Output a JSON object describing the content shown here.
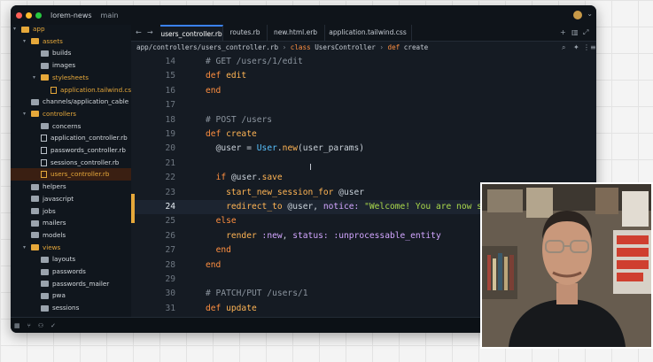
{
  "window": {
    "title": "lorem-news",
    "branch": "main",
    "colors": {
      "bg": "#151b23",
      "accent": "#ff8f40",
      "folder": "#e6a83a",
      "active_tab": "#3b82f6"
    }
  },
  "sidebar": {
    "items": [
      {
        "label": "app",
        "kind": "folder",
        "depth": 0,
        "orange": true,
        "open": true
      },
      {
        "label": "assets",
        "kind": "folder",
        "depth": 1,
        "orange": true,
        "open": true
      },
      {
        "label": "builds",
        "kind": "folder",
        "depth": 2,
        "orange": false
      },
      {
        "label": "images",
        "kind": "folder",
        "depth": 2,
        "orange": false
      },
      {
        "label": "stylesheets",
        "kind": "folder",
        "depth": 2,
        "orange": true,
        "open": true
      },
      {
        "label": "application.tailwind.css",
        "kind": "file",
        "depth": 3,
        "orange": true
      },
      {
        "label": "channels/application_cable",
        "kind": "folder",
        "depth": 1,
        "orange": false
      },
      {
        "label": "controllers",
        "kind": "folder",
        "depth": 1,
        "orange": true,
        "open": true
      },
      {
        "label": "concerns",
        "kind": "folder",
        "depth": 2,
        "orange": false
      },
      {
        "label": "application_controller.rb",
        "kind": "file",
        "depth": 2,
        "orange": false
      },
      {
        "label": "passwords_controller.rb",
        "kind": "file",
        "depth": 2,
        "orange": false
      },
      {
        "label": "sessions_controller.rb",
        "kind": "file",
        "depth": 2,
        "orange": false
      },
      {
        "label": "users_controller.rb",
        "kind": "file",
        "depth": 2,
        "orange": true,
        "active": true
      },
      {
        "label": "helpers",
        "kind": "folder",
        "depth": 1,
        "orange": false
      },
      {
        "label": "javascript",
        "kind": "folder",
        "depth": 1,
        "orange": false
      },
      {
        "label": "jobs",
        "kind": "folder",
        "depth": 1,
        "orange": false
      },
      {
        "label": "mailers",
        "kind": "folder",
        "depth": 1,
        "orange": false
      },
      {
        "label": "models",
        "kind": "folder",
        "depth": 1,
        "orange": false
      },
      {
        "label": "views",
        "kind": "folder",
        "depth": 1,
        "orange": true,
        "open": true
      },
      {
        "label": "layouts",
        "kind": "folder",
        "depth": 2,
        "orange": false
      },
      {
        "label": "passwords",
        "kind": "folder",
        "depth": 2,
        "orange": false
      },
      {
        "label": "passwords_mailer",
        "kind": "folder",
        "depth": 2,
        "orange": false
      },
      {
        "label": "pwa",
        "kind": "folder",
        "depth": 2,
        "orange": false
      },
      {
        "label": "sessions",
        "kind": "folder",
        "depth": 2,
        "orange": false
      }
    ]
  },
  "tabs": [
    {
      "label": "users_controller.rb",
      "active": true
    },
    {
      "label": "routes.rb",
      "active": false
    },
    {
      "label": "new.html.erb",
      "active": false
    },
    {
      "label": "application.tailwind.css",
      "active": false
    }
  ],
  "breadcrumb": {
    "path": "app/controllers/users_controller.rb",
    "sep": "›",
    "class_kw": "class",
    "class_name": "UsersController",
    "def_kw": "def",
    "method": "create"
  },
  "code": [
    {
      "n": "14",
      "tokens": [
        [
          "com",
          "# GET /users/1/edit"
        ]
      ]
    },
    {
      "n": "15",
      "tokens": [
        [
          "kw",
          "def"
        ],
        [
          "plain",
          " "
        ],
        [
          "fn",
          "edit"
        ]
      ]
    },
    {
      "n": "16",
      "tokens": [
        [
          "kw",
          "end"
        ]
      ]
    },
    {
      "n": "17",
      "tokens": []
    },
    {
      "n": "18",
      "tokens": [
        [
          "com",
          "# POST /users"
        ]
      ]
    },
    {
      "n": "19",
      "tokens": [
        [
          "kw",
          "def"
        ],
        [
          "plain",
          " "
        ],
        [
          "fn",
          "create"
        ]
      ]
    },
    {
      "n": "20",
      "tokens": [
        [
          "plain",
          "  "
        ],
        [
          "ivar",
          "@user"
        ],
        [
          "plain",
          " = "
        ],
        [
          "cls",
          "User"
        ],
        [
          "plain",
          "."
        ],
        [
          "fn",
          "new"
        ],
        [
          "plain",
          "(user_params)"
        ]
      ]
    },
    {
      "n": "21",
      "tokens": []
    },
    {
      "n": "22",
      "tokens": [
        [
          "plain",
          "  "
        ],
        [
          "kw",
          "if"
        ],
        [
          "plain",
          " @user."
        ],
        [
          "fn",
          "save"
        ]
      ]
    },
    {
      "n": "23",
      "tokens": [
        [
          "plain",
          "    "
        ],
        [
          "fn",
          "start_new_session_for"
        ],
        [
          "plain",
          " @user"
        ]
      ]
    },
    {
      "n": "24",
      "current": true,
      "tokens": [
        [
          "plain",
          "    "
        ],
        [
          "fn",
          "redirect_to"
        ],
        [
          "plain",
          " @user, "
        ],
        [
          "sym",
          "notice:"
        ],
        [
          "plain",
          " "
        ],
        [
          "str",
          "\"Welcome! You are now si"
        ]
      ]
    },
    {
      "n": "25",
      "tokens": [
        [
          "plain",
          "  "
        ],
        [
          "kw",
          "else"
        ]
      ]
    },
    {
      "n": "26",
      "tokens": [
        [
          "plain",
          "    "
        ],
        [
          "fn",
          "render"
        ],
        [
          "plain",
          " "
        ],
        [
          "sym",
          ":new"
        ],
        [
          "plain",
          ", "
        ],
        [
          "sym",
          "status:"
        ],
        [
          "plain",
          " "
        ],
        [
          "sym",
          ":unprocessable_entity"
        ]
      ]
    },
    {
      "n": "27",
      "tokens": [
        [
          "plain",
          "  "
        ],
        [
          "kw",
          "end"
        ]
      ]
    },
    {
      "n": "28",
      "tokens": [
        [
          "kw",
          "end"
        ]
      ]
    },
    {
      "n": "29",
      "tokens": []
    },
    {
      "n": "30",
      "tokens": [
        [
          "com",
          "# PATCH/PUT /users/1"
        ]
      ]
    },
    {
      "n": "31",
      "tokens": [
        [
          "kw",
          "def"
        ],
        [
          "plain",
          " "
        ],
        [
          "fn",
          "update"
        ]
      ]
    }
  ],
  "icons": {
    "tab_back": "←",
    "tab_fwd": "→",
    "tab_add": "+",
    "tab_split": "▥",
    "tab_expand": "⤢",
    "bc_search": "⌕",
    "bc_bolt": "✦",
    "bc_menu": "⋮",
    "bc_panel": "≡",
    "status_check": "✓",
    "status_people": "⚇",
    "status_branch": "⑂"
  }
}
